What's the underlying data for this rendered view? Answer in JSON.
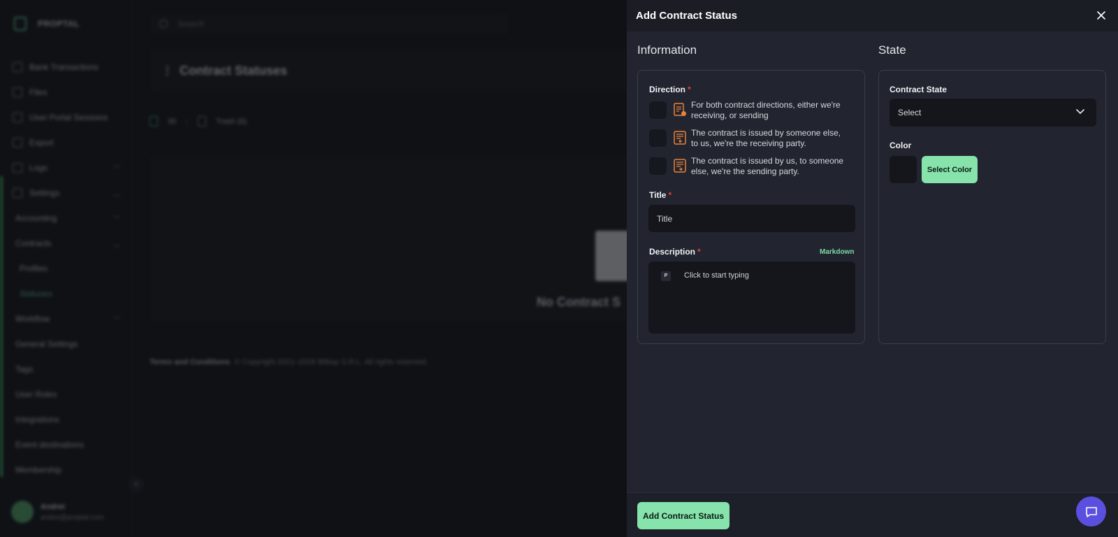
{
  "background": {
    "brand_name": "PROPTAL",
    "search_placeholder": "Search",
    "nav_items": [
      {
        "label": "Bank Transactions"
      },
      {
        "label": "Files"
      },
      {
        "label": "User Portal Sessions"
      },
      {
        "label": "Export"
      },
      {
        "label": "Logs"
      },
      {
        "label": "Settings"
      },
      {
        "label": "Accounting"
      },
      {
        "label": "Contracts"
      },
      {
        "label": "Profiles"
      },
      {
        "label": "Statuses"
      },
      {
        "label": "Workflow"
      },
      {
        "label": "General Settings"
      },
      {
        "label": "Tags"
      },
      {
        "label": "User Roles"
      },
      {
        "label": "Integrations"
      },
      {
        "label": "Event destinations"
      },
      {
        "label": "Membership"
      }
    ],
    "page_title": "Contract Statuses",
    "toolbar_count": "30",
    "trash_label": "Trash (6)",
    "empty_state": "No Contract S",
    "footer_link": "Terms and Conditions",
    "footer_copyright": "© Copyright 2021–2026 Bitbay S.R.L. All rights reserved.",
    "user_name": "Andrei",
    "user_email": "andrei@proptal.com"
  },
  "drawer": {
    "title": "Add Contract Status",
    "information_heading": "Information",
    "state_heading": "State",
    "direction_label": "Direction",
    "direction_options": [
      {
        "text": "For both contract directions, either we're receiving, or sending",
        "icon": "contract-both-icon"
      },
      {
        "text": "The contract is issued by someone else, to us, we're the receiving party.",
        "icon": "contract-receiving-icon"
      },
      {
        "text": "The contract is issued by us, to someone else, we're the sending party.",
        "icon": "contract-sending-icon"
      }
    ],
    "title_label": "Title",
    "title_placeholder": "Title",
    "description_label": "Description",
    "markdown_label": "Markdown",
    "paragraph_badge": "P",
    "description_placeholder": "Click to start typing",
    "contract_state_label": "Contract State",
    "contract_state_value": "Select",
    "color_label": "Color",
    "select_color_button": "Select Color",
    "submit_button": "Add Contract Status",
    "required_marker": "*"
  },
  "colors": {
    "accent_green": "#86e3ab",
    "required_red": "#e0443c",
    "chat_purple": "#5b4fe0",
    "icon_orange": "#e8823a"
  }
}
